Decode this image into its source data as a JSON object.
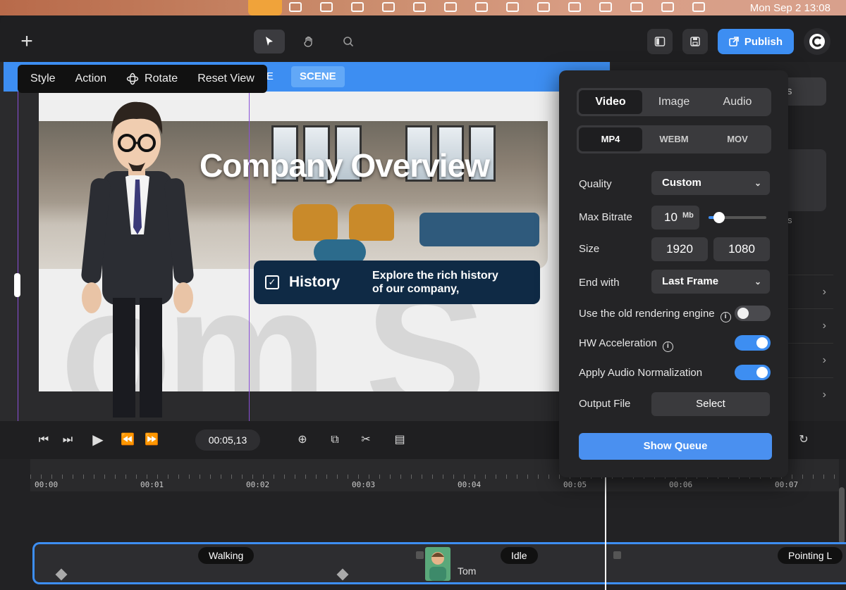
{
  "menubar": {
    "clock": "Mon Sep 2  13:08"
  },
  "toolbar": {
    "publish_label": "Publish"
  },
  "canvas": {
    "tab_partial": "NE",
    "scene_tag": "SCENE",
    "context_menu": {
      "style": "Style",
      "action": "Action",
      "rotate": "Rotate",
      "reset_view": "Reset View"
    },
    "slide": {
      "title": "Company Overview",
      "card_heading": "History",
      "card_text_line1": "Explore the rich history",
      "card_text_line2": "of our company,"
    }
  },
  "right_panel": {
    "partial_tab": "ects",
    "partial_text": "s"
  },
  "export": {
    "media_tabs": [
      "Video",
      "Image",
      "Audio"
    ],
    "selected_media": "Video",
    "formats": [
      "MP4",
      "WEBM",
      "MOV"
    ],
    "selected_format": "MP4",
    "quality_label": "Quality",
    "quality_value": "Custom",
    "bitrate_label": "Max Bitrate",
    "bitrate_value": "10",
    "bitrate_unit": "Mb",
    "bitrate_slider_fraction": 0.18,
    "size_label": "Size",
    "width": "1920",
    "height": "1080",
    "end_with_label": "End with",
    "end_with_value": "Last Frame",
    "old_engine_label": "Use the old rendering engine",
    "old_engine_on": false,
    "hw_accel_label": "HW Acceleration",
    "hw_accel_on": true,
    "audio_norm_label": "Apply Audio Normalization",
    "audio_norm_on": true,
    "output_label": "Output File",
    "select_label": "Select",
    "show_queue_label": "Show Queue"
  },
  "playback": {
    "time": "00:05,13"
  },
  "timeline": {
    "ticks": [
      "00:00",
      "00:01",
      "00:02",
      "00:03",
      "00:04",
      "00:05",
      "00:06",
      "00:07"
    ],
    "clips": [
      "Walking",
      "Idle",
      "Pointing L"
    ],
    "track_name": "Tom"
  },
  "colors": {
    "accent": "#3d8ef2",
    "panel": "#242426",
    "menubar_active": "#f0a33a",
    "card": "#0f2a45"
  }
}
